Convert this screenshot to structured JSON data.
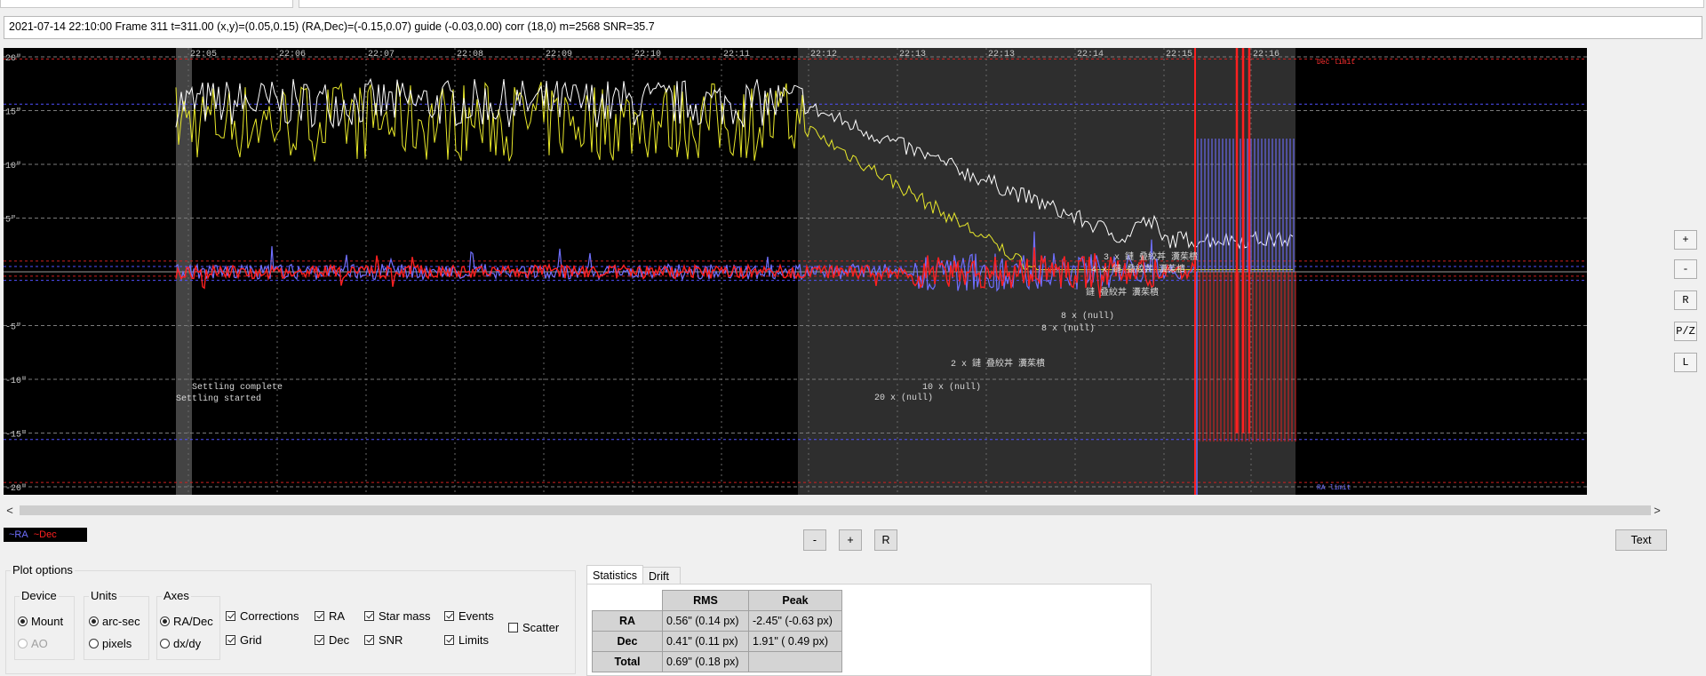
{
  "status_line": "2021-07-14 22:10:00 Frame 311 t=311.00 (x,y)=(0.05,0.15) (RA,Dec)=(-0.15,0.07) guide (-0.03,0.00) corr (18,0) m=2568 SNR=35.7",
  "plot": {
    "y_tick_labels": [
      "20\"",
      "15\"",
      "10\"",
      "5\"",
      "-5\"",
      "-10\"",
      "-15\"",
      "-20\""
    ],
    "time_labels": [
      "22:05",
      "22:06",
      "22:07",
      "22:08",
      "22:09",
      "22:10",
      "22:11",
      "22:12",
      "22:13",
      "22:13",
      "22:14",
      "22:15",
      "22:16"
    ],
    "annotations": [
      "3 x 鏈  叠絞丼  瀵茱樻",
      "4 x 鏈  叠絞丼  瀵茱樻",
      "鏈  叠絞丼  瀵茱樻",
      "8 x (null)",
      "8 x (null)",
      "2 x 鏈  叠絞丼  瀵茱樻",
      "10 x (null)",
      "20 x (null)",
      "Settling complete",
      "Settling started"
    ],
    "limit_labels": [
      "Dec limit",
      "RA limit"
    ],
    "colors": {
      "ra": "#6f6fff",
      "dec": "#ff2020",
      "star_mass": "#ffffff",
      "snr": "#e8e82a",
      "background": "#000000",
      "shaded": "#2e2e2e"
    }
  },
  "side_buttons": [
    "+",
    "-",
    "R",
    "P/Z",
    "L"
  ],
  "legend": {
    "ra": "~RA",
    "dec": "~Dec",
    "ra_color": "#6f6fff",
    "dec_color": "#ff2020"
  },
  "zoom_buttons": [
    "-",
    "+",
    "R"
  ],
  "text_button": "Text",
  "plot_options": {
    "title": "Plot options",
    "device": {
      "title": "Device",
      "options": [
        "Mount",
        "AO"
      ]
    },
    "units": {
      "title": "Units",
      "options": [
        "arc-sec",
        "pixels"
      ]
    },
    "axes": {
      "title": "Axes",
      "options": [
        "RA/Dec",
        "dx/dy"
      ]
    },
    "checks": {
      "corrections": "Corrections",
      "grid": "Grid",
      "ra": "RA",
      "dec": "Dec",
      "star_mass": "Star mass",
      "snr": "SNR",
      "events": "Events",
      "limits": "Limits",
      "scatter": "Scatter"
    }
  },
  "tabs": [
    "Statistics",
    "Drift"
  ],
  "stats": {
    "headers": [
      "RMS",
      "Peak"
    ],
    "rows": [
      {
        "label": "RA",
        "rms": "0.56\" (0.14 px)",
        "peak": "-2.45\" (-0.63 px)"
      },
      {
        "label": "Dec",
        "rms": "0.41\" (0.11 px)",
        "peak": "1.91\" ( 0.49 px)"
      },
      {
        "label": "Total",
        "rms": "0.69\" (0.18 px)",
        "peak": ""
      }
    ]
  }
}
